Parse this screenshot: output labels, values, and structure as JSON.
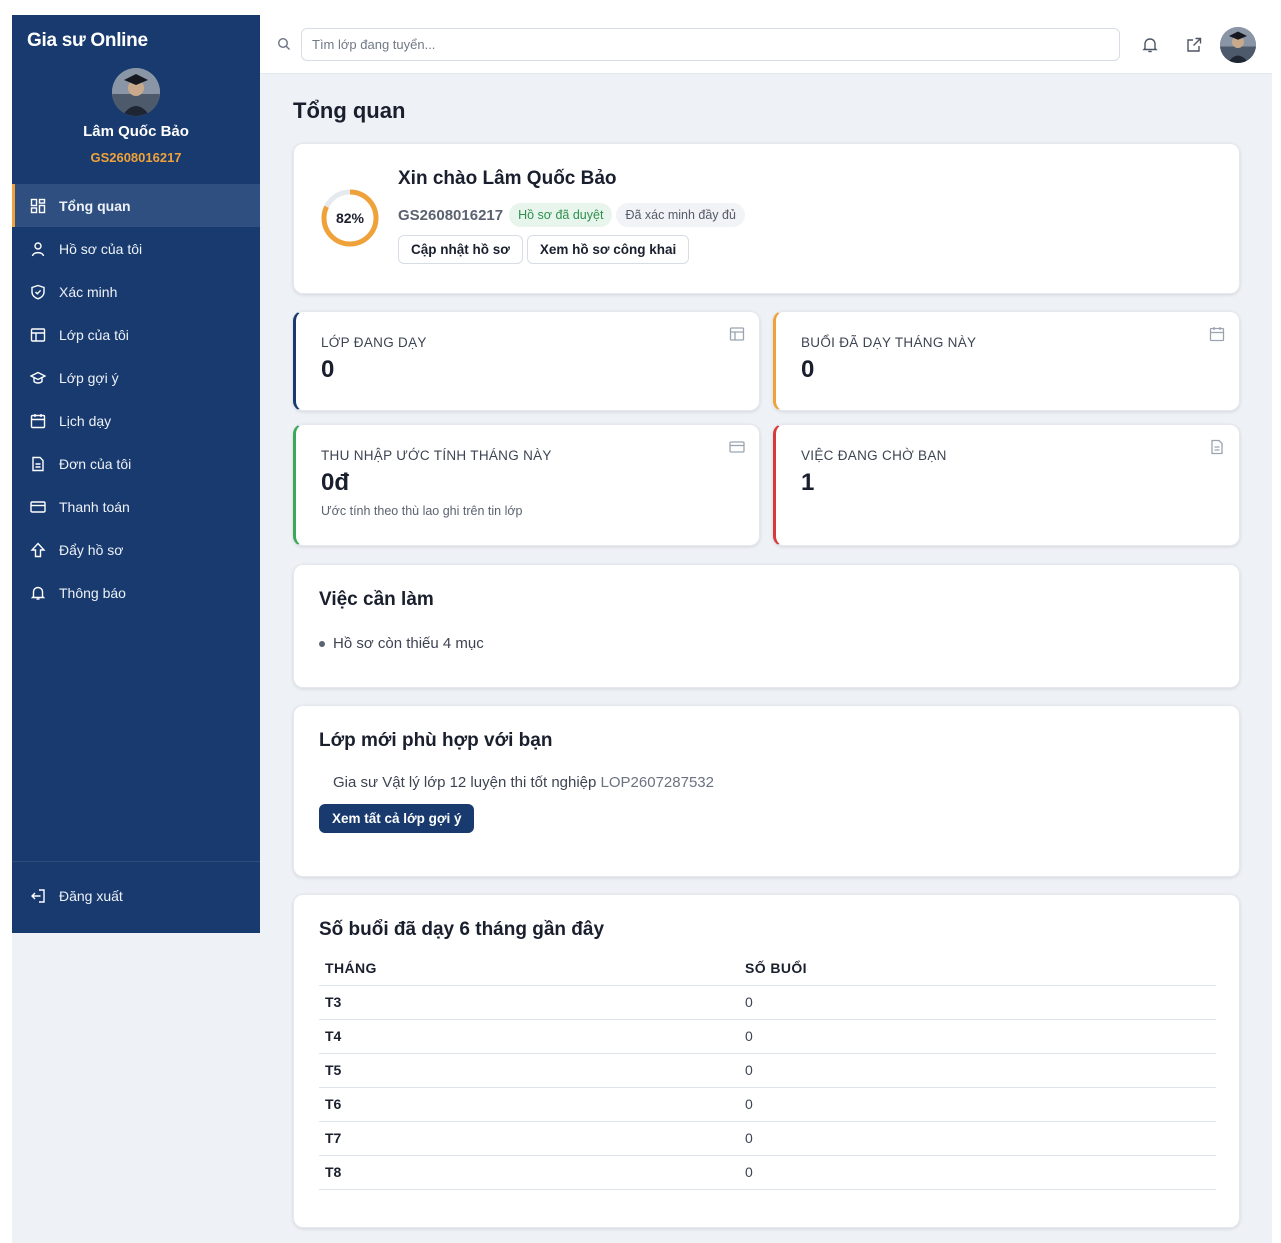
{
  "app": {
    "brand": "Gia sư Online"
  },
  "user": {
    "name": "Lâm Quốc Bảo",
    "code": "GS2608016217"
  },
  "sidebar": {
    "items": [
      {
        "label": "Tổng quan",
        "icon": "dashboard-icon",
        "active": true
      },
      {
        "label": "Hồ sơ của tôi",
        "icon": "user-icon"
      },
      {
        "label": "Xác minh",
        "icon": "shield-icon"
      },
      {
        "label": "Lớp của tôi",
        "icon": "table-icon"
      },
      {
        "label": "Lớp gợi ý",
        "icon": "graduation-cap-icon"
      },
      {
        "label": "Lịch dạy",
        "icon": "calendar-icon"
      },
      {
        "label": "Đơn của tôi",
        "icon": "document-icon"
      },
      {
        "label": "Thanh toán",
        "icon": "credit-card-icon"
      },
      {
        "label": "Đẩy hồ sơ",
        "icon": "arrow-up-icon"
      },
      {
        "label": "Thông báo",
        "icon": "bell-icon"
      }
    ],
    "logout_label": "Đăng xuất"
  },
  "topbar": {
    "search_placeholder": "Tìm lớp đang tuyển..."
  },
  "page": {
    "title": "Tổng quan"
  },
  "welcome": {
    "greeting": "Xin chào Lâm Quốc Bảo",
    "code": "GS2608016217",
    "progress_label": "82%",
    "progress_value": 0.82,
    "badge_approved": "Hồ sơ đã duyệt",
    "badge_verified": "Đã xác minh đầy đủ",
    "update_button": "Cập nhật hồ sơ",
    "public_button": "Xem hồ sơ công khai"
  },
  "stats": [
    {
      "label": "LỚP ĐANG DẠY",
      "value": "0",
      "icon": "table-icon",
      "color": "#183a6e"
    },
    {
      "label": "BUỔI ĐÃ DẠY THÁNG NÀY",
      "value": "0",
      "icon": "calendar-icon",
      "color": "#f0a23a"
    },
    {
      "label": "THU NHẬP ƯỚC TÍNH THÁNG NÀY",
      "value": "0đ",
      "note": "Ước tính theo thù lao ghi trên tin lớp",
      "icon": "credit-card-icon",
      "color": "#3aa856"
    },
    {
      "label": "VIỆC ĐANG CHỜ BẠN",
      "value": "1",
      "icon": "document-icon",
      "color": "#d63b3b"
    }
  ],
  "todo": {
    "title": "Việc cần làm",
    "items": [
      "Hồ sơ còn thiếu 4 mục"
    ]
  },
  "suggested": {
    "title": "Lớp mới phù hợp với bạn",
    "item_text": "Gia sư Vật lý lớp 12 luyện thi tốt nghiệp",
    "item_code": "LOP2607287532",
    "button": "Xem tất cả lớp gợi ý"
  },
  "sessions": {
    "title": "Số buổi đã dạy 6 tháng gần đây",
    "headers": [
      "THÁNG",
      "SỐ BUỔI"
    ],
    "rows": [
      {
        "month": "T3",
        "count": "0"
      },
      {
        "month": "T4",
        "count": "0"
      },
      {
        "month": "T5",
        "count": "0"
      },
      {
        "month": "T6",
        "count": "0"
      },
      {
        "month": "T7",
        "count": "0"
      },
      {
        "month": "T8",
        "count": "0"
      }
    ]
  }
}
